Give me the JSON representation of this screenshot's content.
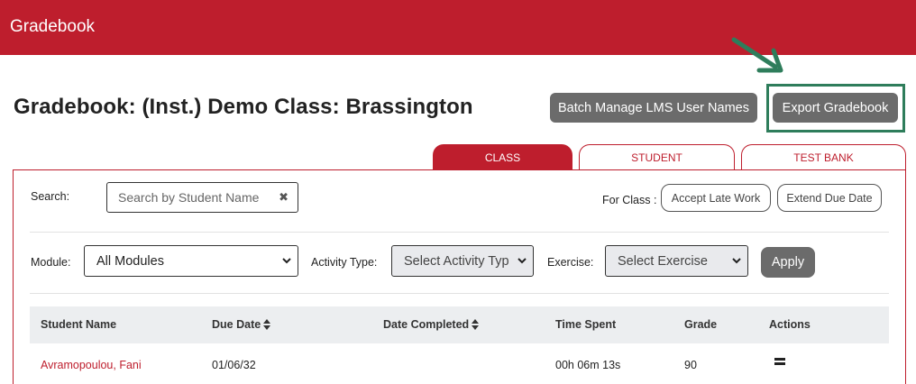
{
  "header": {
    "app_title": "Gradebook"
  },
  "page": {
    "title": "Gradebook: (Inst.) Demo Class: Brassington"
  },
  "actions": {
    "batch_manage_label": "Batch Manage LMS User Names",
    "export_label": "Export Gradebook"
  },
  "annotation": {
    "color": "#2e7d5b"
  },
  "tabs": [
    {
      "label": "CLASS",
      "active": true
    },
    {
      "label": "STUDENT",
      "active": false
    },
    {
      "label": "TEST BANK",
      "active": false
    }
  ],
  "filters": {
    "search_label": "Search:",
    "search_placeholder": "Search by Student Name",
    "for_class_label": "For Class :",
    "accept_late_label": "Accept Late Work",
    "extend_due_label": "Extend Due Date",
    "module_label": "Module:",
    "module_value": "All Modules",
    "activity_label": "Activity Type:",
    "activity_value": "Select Activity Typ",
    "exercise_label": "Exercise:",
    "exercise_value": "Select Exercise",
    "apply_label": "Apply"
  },
  "table": {
    "columns": [
      "Student Name",
      "Due Date",
      "Date Completed",
      "Time Spent",
      "Grade",
      "Actions"
    ],
    "rows": [
      {
        "student_name": "Avramopoulou, Fani",
        "due_date": "01/06/32",
        "date_completed": "",
        "time_spent": "00h 06m 13s",
        "grade": "90"
      }
    ]
  },
  "colors": {
    "brand": "#be1e2d",
    "button": "#6b6b6b",
    "table_header": "#eceef0"
  },
  "icons": {
    "clear": "times-icon",
    "sort": "sort-icon",
    "actions": "menu-icon",
    "select": "chevron-down-icon"
  }
}
